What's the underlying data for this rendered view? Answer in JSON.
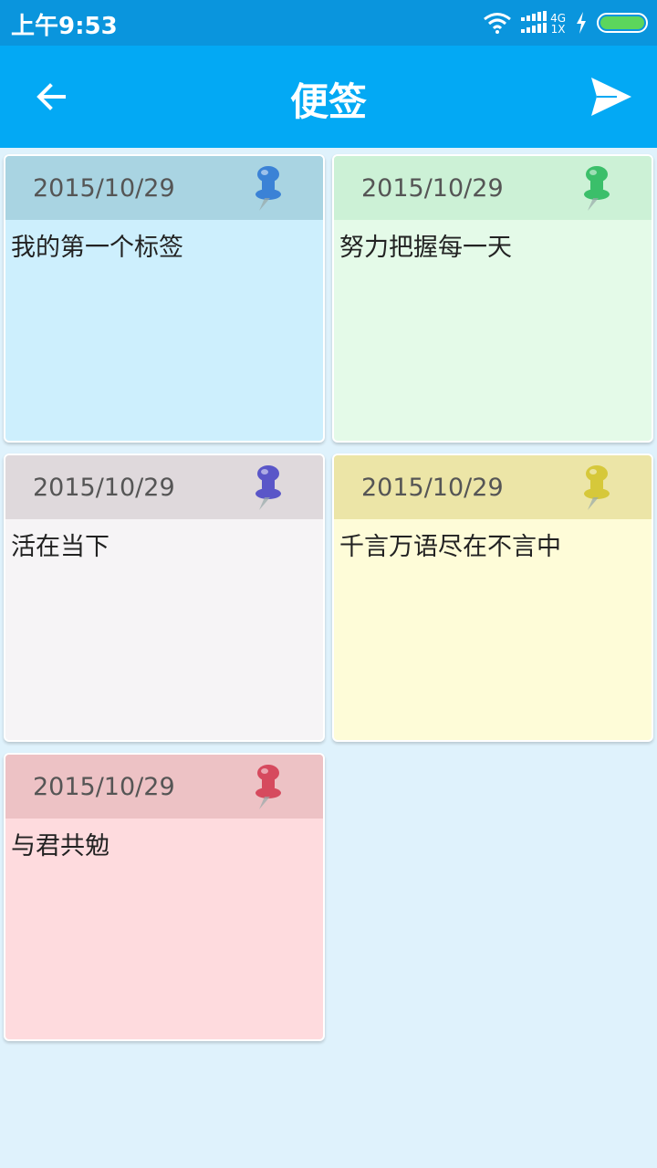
{
  "status_bar": {
    "time": "上午9:53",
    "network_top": "4G",
    "network_bottom": "1X"
  },
  "app_bar": {
    "title": "便签",
    "back_icon": "arrow-left-icon",
    "send_icon": "send-icon"
  },
  "notes": [
    {
      "date": "2015/10/29",
      "text": "我的第一个标签",
      "head_color": "#a9d4e2",
      "body_color": "#cdeffd",
      "pin_color": "#3b82d6"
    },
    {
      "date": "2015/10/29",
      "text": "努力把握每一天",
      "head_color": "#ccf1d6",
      "body_color": "#e4fae8",
      "pin_color": "#3bbf6a"
    },
    {
      "date": "2015/10/29",
      "text": "活在当下",
      "head_color": "#dfd9dc",
      "body_color": "#f6f4f6",
      "pin_color": "#5a56c8"
    },
    {
      "date": "2015/10/29",
      "text": "千言万语尽在不言中",
      "head_color": "#ece5a7",
      "body_color": "#fefcd8",
      "pin_color": "#d6c83a"
    },
    {
      "date": "2015/10/29",
      "text": "与君共勉",
      "head_color": "#edc2c5",
      "body_color": "#fedbde",
      "pin_color": "#d64a5e"
    }
  ]
}
